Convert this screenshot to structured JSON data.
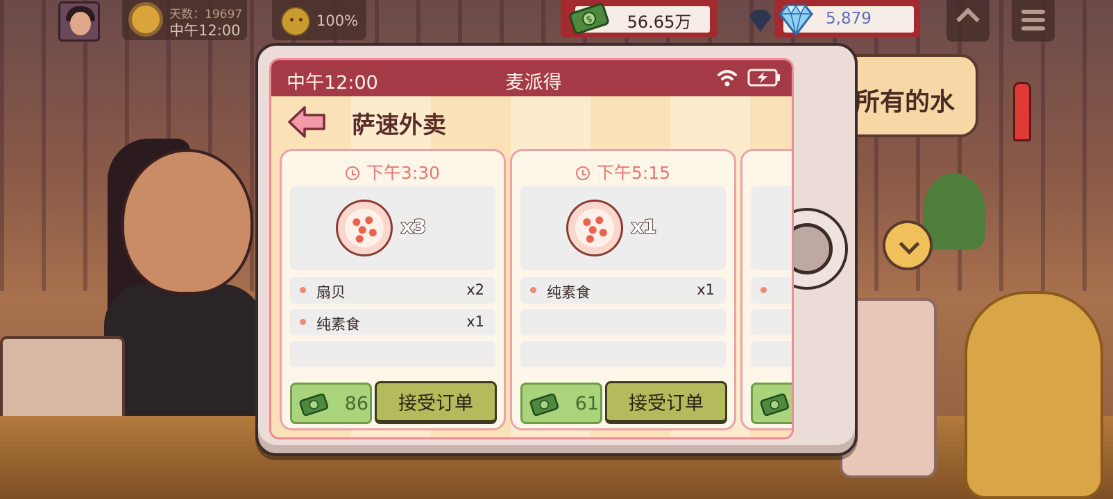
{
  "hud": {
    "day_label": "天数：19697",
    "time_label": "中午12:00",
    "mood_percent": "100%",
    "money": "56.65万",
    "gems": "5,879"
  },
  "background": {
    "speech_text": "所有的水"
  },
  "phone": {
    "status_time": "中午12:00",
    "carrier_title": "麦派得",
    "app_title": "萨速外卖"
  },
  "orders": [
    {
      "time": "下午3:30",
      "dish_qty": "x3",
      "items": [
        {
          "name": "扇贝",
          "qty": "x2"
        },
        {
          "name": "纯素食",
          "qty": "x1"
        }
      ],
      "reward": "86",
      "accept_label": "接受订单"
    },
    {
      "time": "下午5:15",
      "dish_qty": "x1",
      "items": [
        {
          "name": "纯素食",
          "qty": "x1"
        }
      ],
      "reward": "61",
      "accept_label": "接受订单"
    }
  ],
  "colors": {
    "status_bar": "#a43a46",
    "accent_time": "#e9786f",
    "reward_green": "#a9d47c",
    "accept_button": "#b4bb5c"
  },
  "icons": [
    "back-arrow-icon",
    "wifi-icon",
    "battery-charging-icon",
    "clock-icon",
    "pizza-icon",
    "cash-icon",
    "diamond-icon",
    "sun-icon",
    "mood-face-icon",
    "menu-icon",
    "up-arrow-icon"
  ]
}
